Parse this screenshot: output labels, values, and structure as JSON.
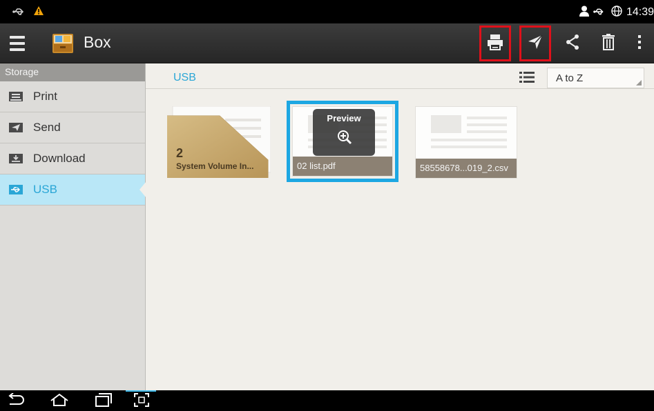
{
  "status_bar": {
    "time": "14:39",
    "left_icons": [
      "usb-icon",
      "warning-icon"
    ],
    "right_icons": [
      "user-icon",
      "usb-icon",
      "globe-icon"
    ]
  },
  "action_bar": {
    "title": "Box",
    "app_icon": "box-app-icon",
    "tools": [
      {
        "name": "print",
        "icon": "print-icon",
        "highlighted": true
      },
      {
        "name": "send",
        "icon": "send-icon",
        "highlighted": true
      },
      {
        "name": "share",
        "icon": "share-icon",
        "highlighted": false
      },
      {
        "name": "delete",
        "icon": "trash-icon",
        "highlighted": false
      },
      {
        "name": "more",
        "icon": "overflow-menu-icon",
        "highlighted": false
      }
    ],
    "highlight_color": "#e0101a"
  },
  "sidebar": {
    "header": "Storage",
    "items": [
      {
        "label": "Print",
        "icon": "printer-icon",
        "selected": false
      },
      {
        "label": "Send",
        "icon": "send-icon",
        "selected": false
      },
      {
        "label": "Download",
        "icon": "download-icon",
        "selected": false
      },
      {
        "label": "USB",
        "icon": "usb-icon",
        "selected": true
      }
    ]
  },
  "main": {
    "breadcrumb": "USB",
    "sort": {
      "selected": "A to Z"
    },
    "view_icon": "list-view-icon",
    "items": [
      {
        "type": "folder",
        "count": "2",
        "label": "System Volume In..."
      },
      {
        "type": "file",
        "label": "02 list.pdf",
        "selected": true,
        "preview_label": "Preview"
      },
      {
        "type": "file",
        "label": "58558678...019_2.csv",
        "selected": false
      }
    ],
    "accent": "#2aa6d6",
    "selection_color": "#1da7e2"
  },
  "nav_bar": {
    "buttons": [
      "back-icon",
      "home-icon",
      "recent-apps-icon",
      "screen-capture-icon"
    ]
  }
}
